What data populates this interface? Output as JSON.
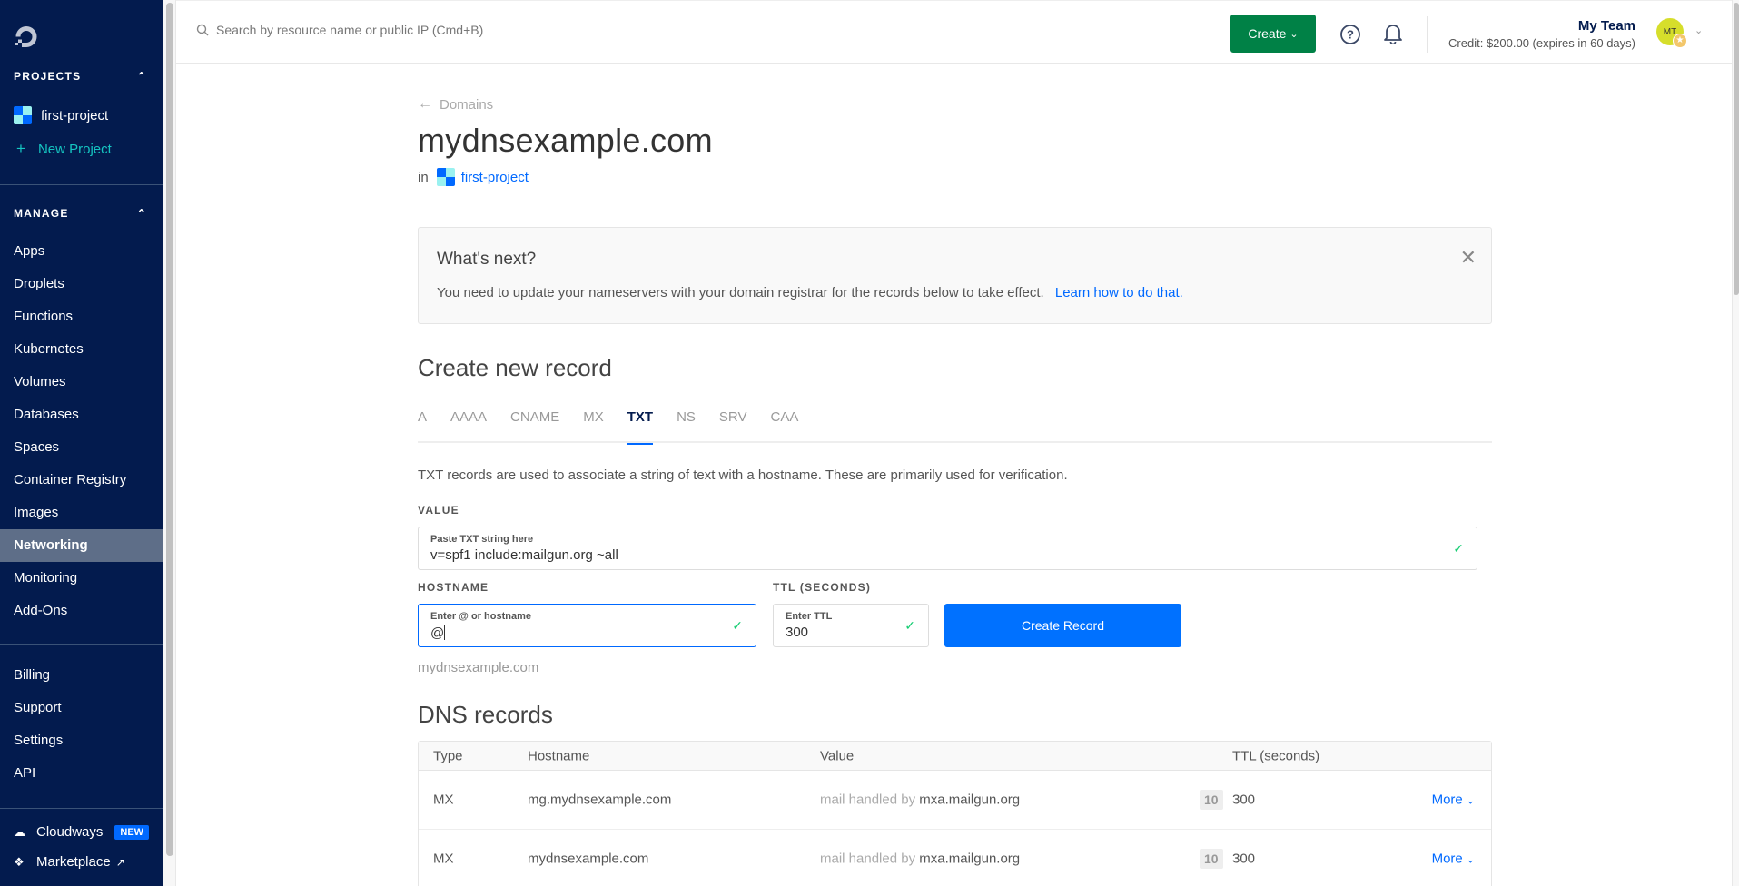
{
  "sidebar": {
    "logo_icon": "digitalocean-logo",
    "projects_heading": "PROJECTS",
    "projects": [
      {
        "label": "first-project"
      }
    ],
    "new_project_label": "New Project",
    "manage_heading": "MANAGE",
    "manage_items": [
      {
        "label": "Apps",
        "active": false
      },
      {
        "label": "Droplets",
        "active": false
      },
      {
        "label": "Functions",
        "active": false
      },
      {
        "label": "Kubernetes",
        "active": false
      },
      {
        "label": "Volumes",
        "active": false
      },
      {
        "label": "Databases",
        "active": false
      },
      {
        "label": "Spaces",
        "active": false
      },
      {
        "label": "Container Registry",
        "active": false
      },
      {
        "label": "Images",
        "active": false
      },
      {
        "label": "Networking",
        "active": true
      },
      {
        "label": "Monitoring",
        "active": false
      },
      {
        "label": "Add-Ons",
        "active": false
      }
    ],
    "account_items": [
      {
        "label": "Billing"
      },
      {
        "label": "Support"
      },
      {
        "label": "Settings"
      },
      {
        "label": "API"
      }
    ],
    "cloudways_label": "Cloudways",
    "cloudways_badge": "NEW",
    "marketplace_label": "Marketplace"
  },
  "topbar": {
    "search_placeholder": "Search by resource name or public IP (Cmd+B)",
    "create_label": "Create",
    "team_name": "My Team",
    "credit": "Credit: $200.00 (expires in 60 days)",
    "avatar_initials": "MT"
  },
  "page": {
    "back_label": "Domains",
    "title": "mydnsexample.com",
    "in_label": "in",
    "project_link": "first-project"
  },
  "notice": {
    "title": "What's next?",
    "text": "You need to update your nameservers with your domain registrar for the records below to take effect.",
    "link": "Learn how to do that."
  },
  "create_record": {
    "heading": "Create new record",
    "tabs": [
      {
        "label": "A",
        "active": false
      },
      {
        "label": "AAAA",
        "active": false
      },
      {
        "label": "CNAME",
        "active": false
      },
      {
        "label": "MX",
        "active": false
      },
      {
        "label": "TXT",
        "active": true
      },
      {
        "label": "NS",
        "active": false
      },
      {
        "label": "SRV",
        "active": false
      },
      {
        "label": "CAA",
        "active": false
      }
    ],
    "description": "TXT records are used to associate a string of text with a hostname. These are primarily used for verification.",
    "value_label": "VALUE",
    "value_field_label": "Paste TXT string here",
    "value": "v=spf1 include:mailgun.org ~all",
    "hostname_label": "HOSTNAME",
    "hostname_field_label": "Enter @ or hostname",
    "hostname": "@",
    "hostname_hint": "mydnsexample.com",
    "ttl_label": "TTL (SECONDS)",
    "ttl_field_label": "Enter TTL",
    "ttl": "300",
    "submit_label": "Create Record"
  },
  "dns_records": {
    "heading": "DNS records",
    "columns": [
      "Type",
      "Hostname",
      "Value",
      "TTL (seconds)"
    ],
    "rows": [
      {
        "type": "MX",
        "hostname": "mg.mydnsexample.com",
        "value_prefix": "mail handled by",
        "value": "mxa.mailgun.org",
        "priority": "10",
        "ttl": "300",
        "action": "More"
      },
      {
        "type": "MX",
        "hostname": "mydnsexample.com",
        "value_prefix": "mail handled by",
        "value": "mxa.mailgun.org",
        "priority": "10",
        "ttl": "300",
        "action": "More"
      }
    ]
  },
  "colors": {
    "sidebar_bg": "#031b4e",
    "accent_blue": "#0069ff",
    "create_green": "#008146",
    "check_green": "#15cd72"
  }
}
